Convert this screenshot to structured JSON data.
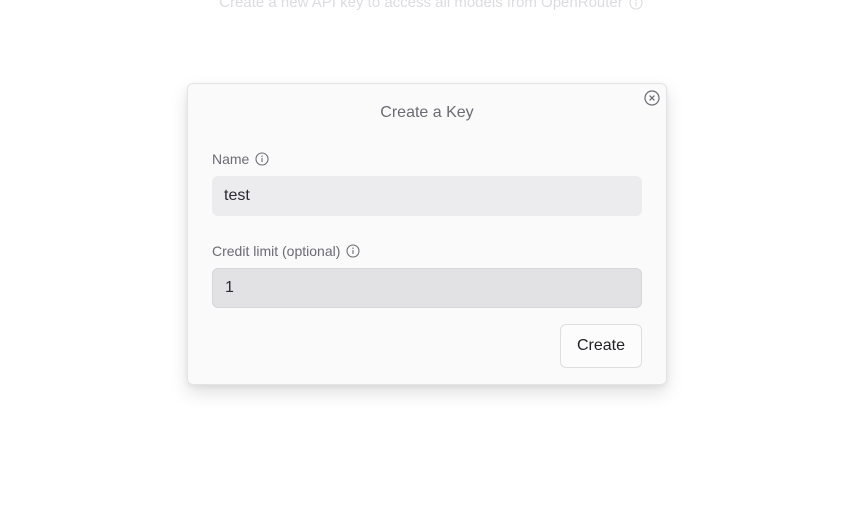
{
  "background": {
    "subtitle": "Create a new API key to access all models from OpenRouter"
  },
  "modal": {
    "title": "Create a Key",
    "close_icon": "close-circle-icon",
    "name_field": {
      "label": "Name",
      "value": "test",
      "info_icon": "info-icon"
    },
    "credit_field": {
      "label": "Credit limit (optional)",
      "value": "1",
      "info_icon": "info-icon"
    },
    "create_label": "Create"
  },
  "colors": {
    "modal_bg": "#fafafa",
    "input_bg": "#ececee",
    "muted_text": "#6b6b74"
  }
}
